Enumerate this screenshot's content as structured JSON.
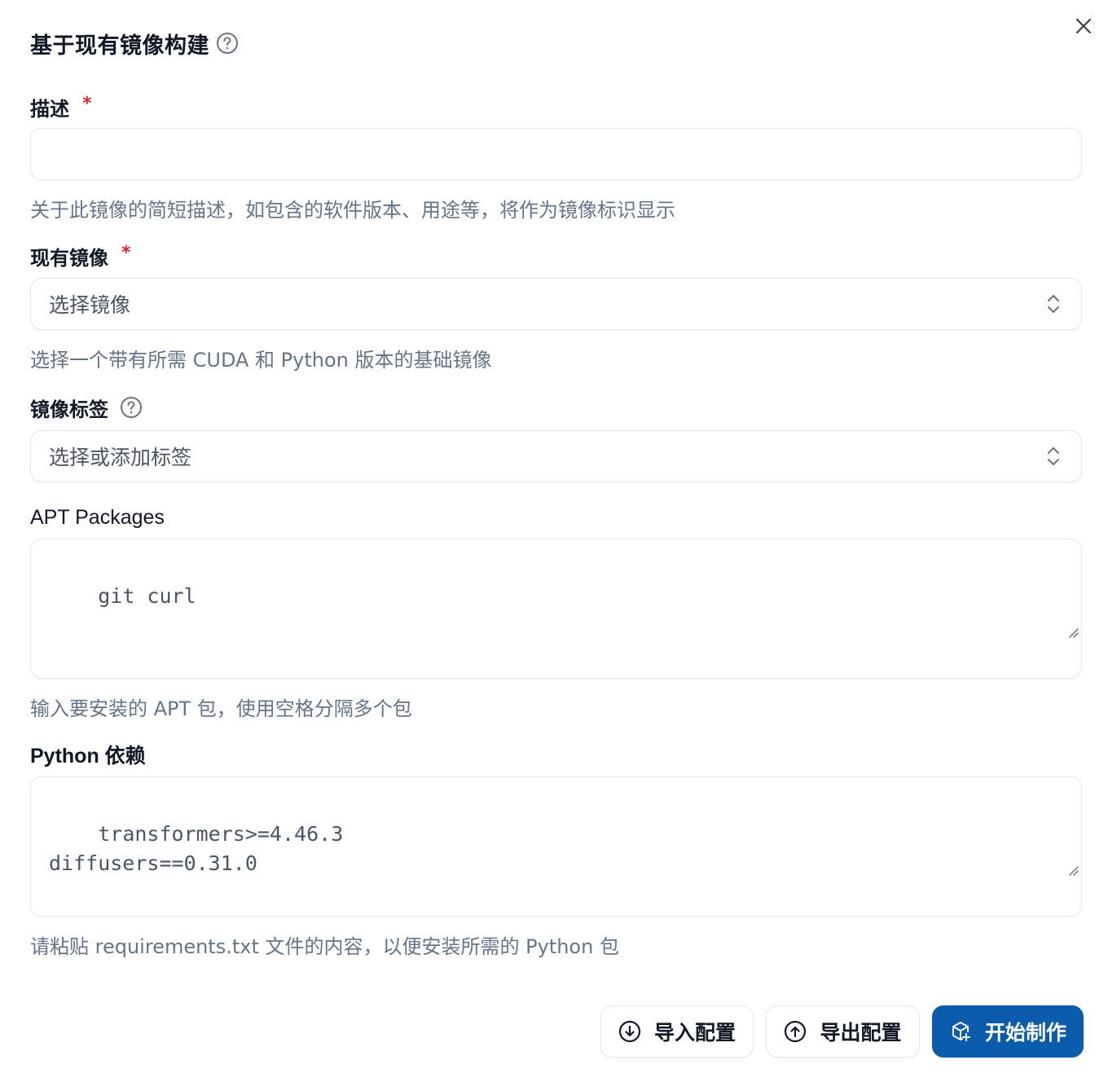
{
  "dialog": {
    "title": "基于现有镜像构建",
    "title_help_icon": "help-circle-icon",
    "close_icon": "close-icon"
  },
  "fields": {
    "description": {
      "label": "描述",
      "required_mark": "*",
      "value": "",
      "helper": "关于此镜像的简短描述，如包含的软件版本、用途等，将作为镜像标识显示"
    },
    "existing_image": {
      "label": "现有镜像",
      "required_mark": "*",
      "placeholder": "选择镜像",
      "helper": "选择一个带有所需 CUDA 和 Python 版本的基础镜像"
    },
    "image_tags": {
      "label": "镜像标签",
      "help_icon": "help-circle-icon",
      "placeholder": "选择或添加标签"
    },
    "apt_packages": {
      "label": "APT Packages",
      "placeholder": "git curl",
      "helper": "输入要安装的 APT 包，使用空格分隔多个包"
    },
    "python_deps": {
      "label": "Python 依赖",
      "placeholder": "transformers>=4.46.3\ndiffusers==0.31.0",
      "helper": "请粘贴 requirements.txt 文件的内容，以便安装所需的 Python 包"
    }
  },
  "footer": {
    "import_label": "导入配置",
    "import_icon": "arrow-down-circle-icon",
    "export_label": "导出配置",
    "export_icon": "arrow-up-circle-icon",
    "start_label": "开始制作",
    "start_icon": "package-plus-icon"
  },
  "colors": {
    "primary": "#0b5cad",
    "required": "#dc2626",
    "helper_text": "#64748b",
    "border": "#e5e7eb"
  }
}
